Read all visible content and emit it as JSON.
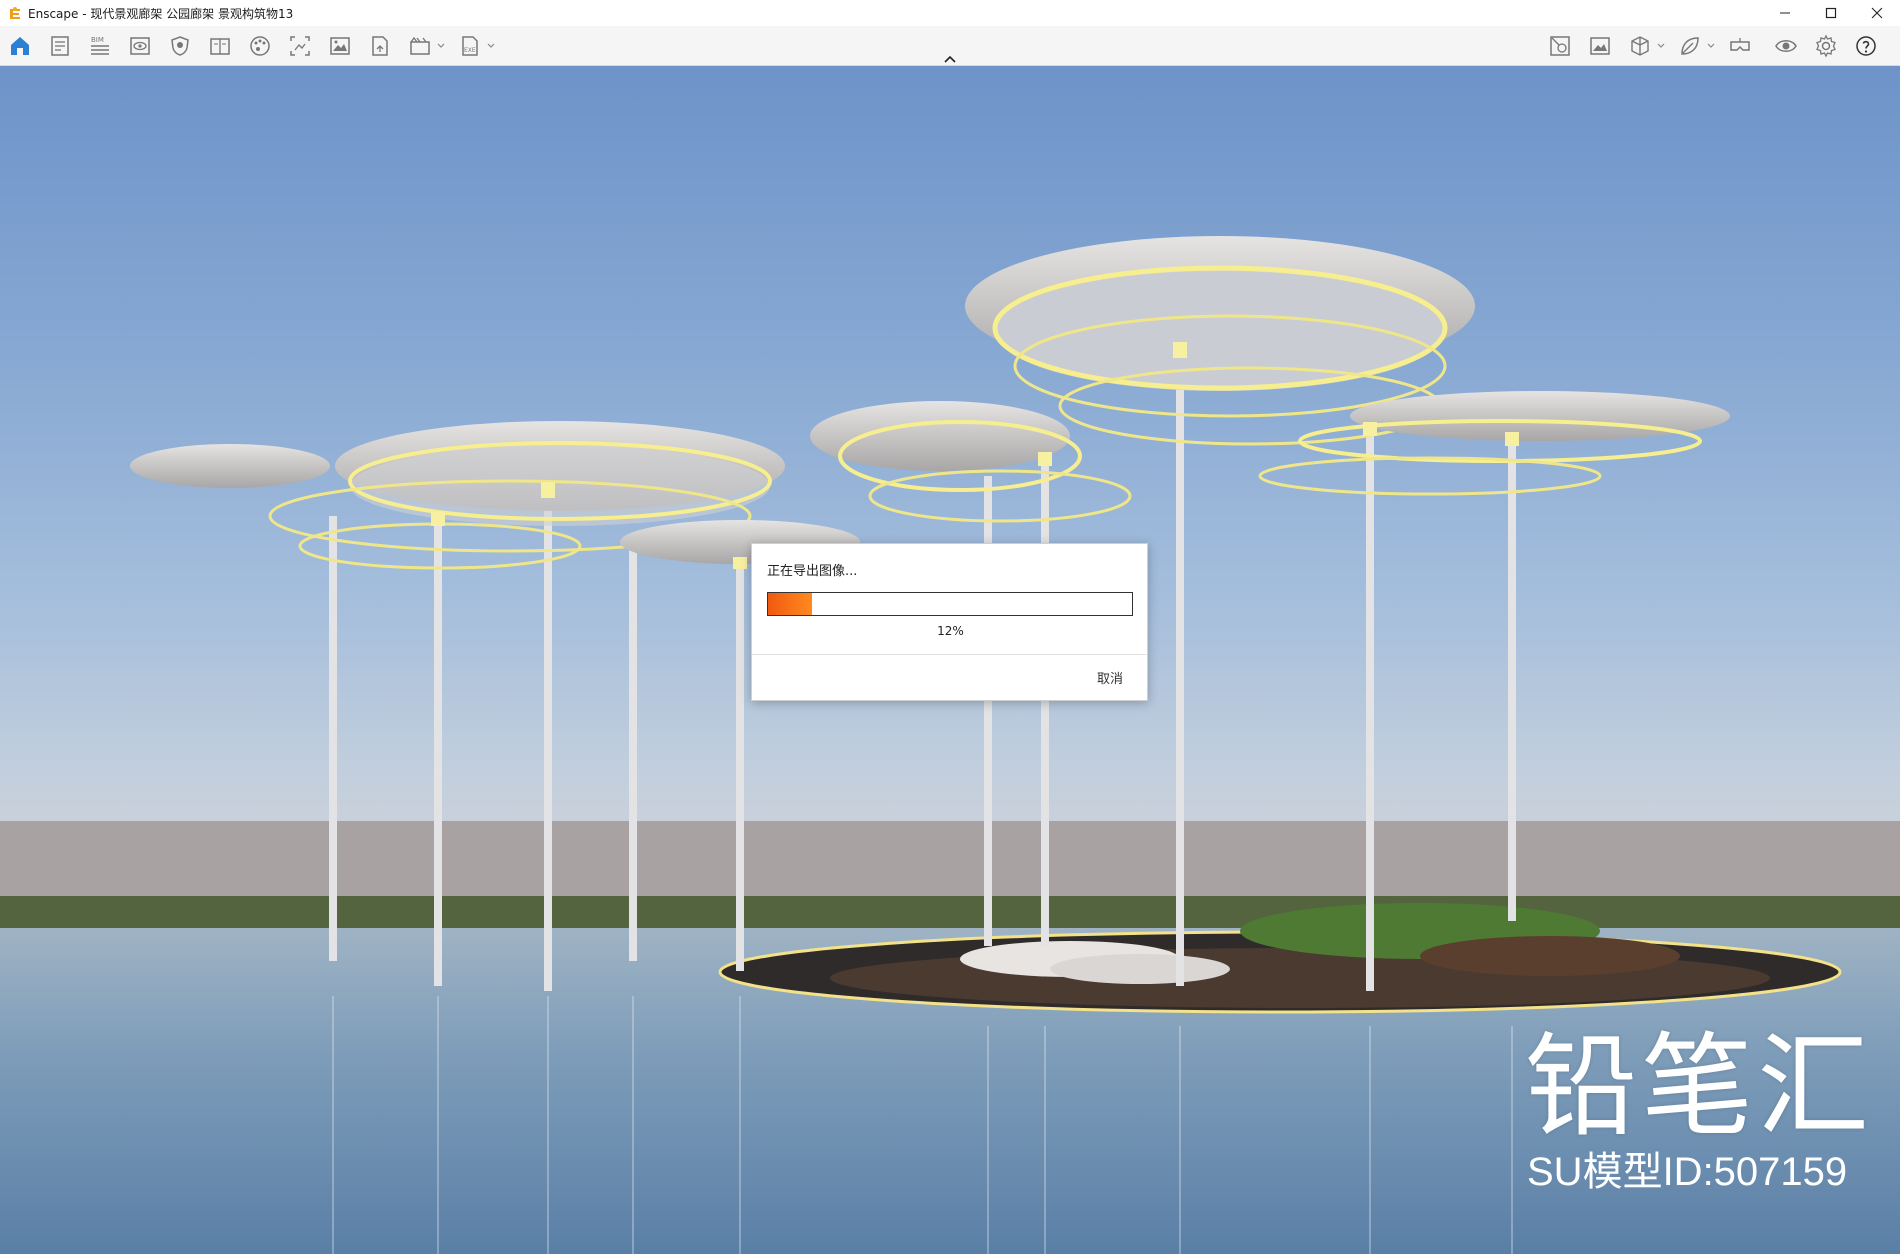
{
  "window": {
    "title": "Enscape - 现代景观廊架 公园廊架 景观构筑物13",
    "controls": [
      "minimize-icon",
      "maximize-icon",
      "close-icon"
    ]
  },
  "toolbar": {
    "left_icons": [
      "home-icon",
      "document-icon",
      "bim-icon",
      "view-icon",
      "shield-icon",
      "book-icon",
      "palette-icon",
      "screenshot-icon",
      "image-icon",
      "file-export-icon",
      "video-icon",
      "exe-export-icon"
    ],
    "bim_label": "BIM",
    "exe_label": "EXE",
    "right_icons": [
      "asset-library-icon",
      "gallery-icon",
      "cube-icon",
      "leaf-icon",
      "vr-headset-icon",
      "eye-icon",
      "settings-icon",
      "help-icon"
    ],
    "accent_color": "#2d7fd3"
  },
  "dialog": {
    "title": "正在导出图像...",
    "progress_percent": 12,
    "progress_text": "12%",
    "cancel_label": "取消",
    "progress_color": "#f26a14"
  },
  "watermark": {
    "brand": "铅笔汇",
    "model_id": "SU模型ID:507159"
  }
}
